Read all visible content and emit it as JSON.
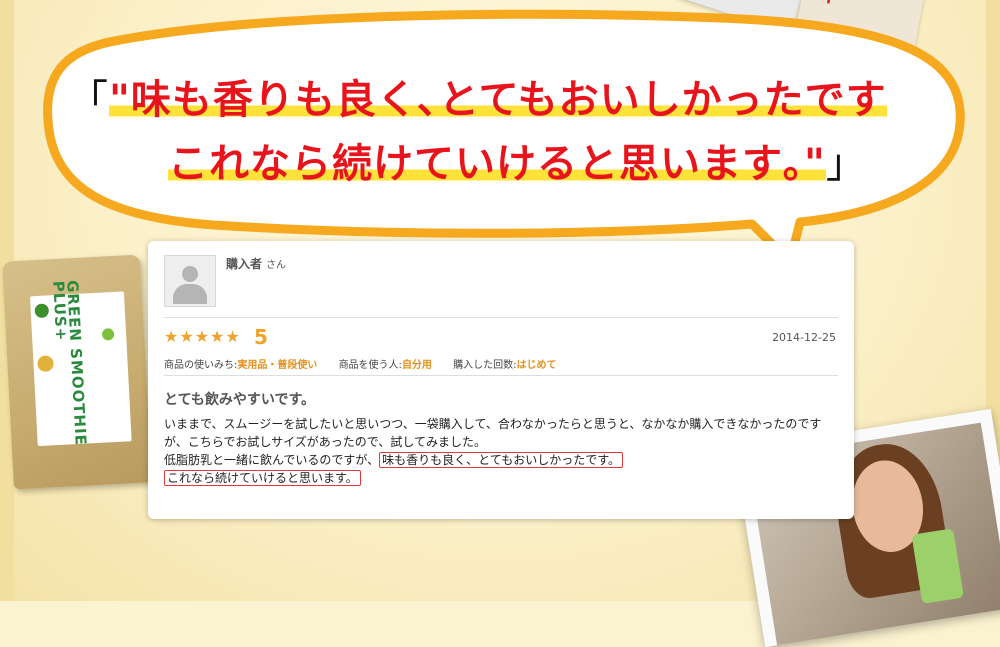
{
  "headline": {
    "open_bracket": "「",
    "line1": "\"味も香りも良く､とてもおいしかったです",
    "line2": "これなら続けていけると思います｡\"",
    "close_bracket": "」"
  },
  "package_top_text": "+",
  "pouch": {
    "brand": "GREEN SMOOTHIE PLUS+"
  },
  "review": {
    "reviewer_name": "購入者",
    "reviewer_suffix": "さん",
    "stars": "★★★★★",
    "score": "5",
    "date": "2014-12-25",
    "meta": [
      {
        "key": "商品の使いみち:",
        "value": "実用品・普段使い"
      },
      {
        "key": "商品を使う人:",
        "value": "自分用"
      },
      {
        "key": "購入した回数:",
        "value": "はじめて"
      }
    ],
    "title": "とても飲みやすいです。",
    "body_line1": "いままで、スムージーを試したいと思いつつ、一袋購入して、合わなかったらと思うと、なかなか購入できなかったのです",
    "body_line2": "が、こちらでお試しサイズがあったので、試してみました。",
    "body_line3_plain": "低脂肪乳と一緒に飲んでいるのですが、",
    "body_line3_boxed": "味も香りも良く、とてもおいしかったです。",
    "body_line4_boxed": "これなら続けていけると思います。"
  },
  "colors": {
    "headline_red": "#e8141b",
    "highlight_yellow": "#fde23a",
    "bubble_border": "#f6a81e",
    "star_orange": "#f0a22a",
    "box_red": "#e03a3a"
  }
}
